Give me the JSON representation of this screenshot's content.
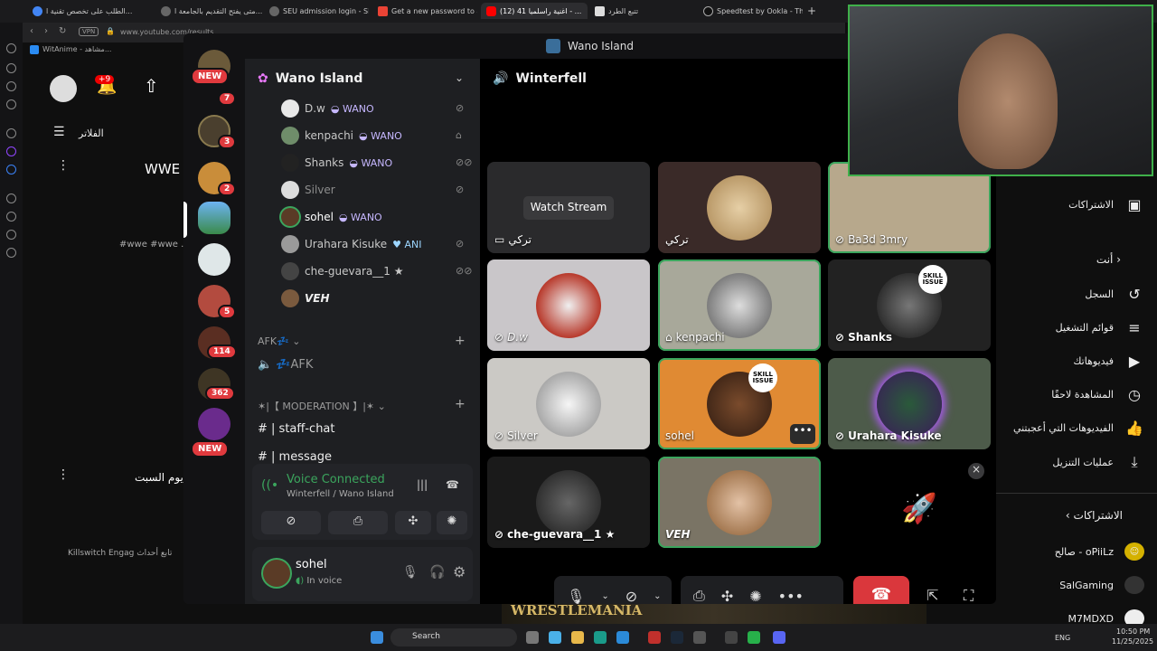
{
  "browser": {
    "tabs": [
      "الطلب على تخصص تقنية ا...",
      "متى يفتح التقديم بالجامعة ا...",
      "SEU admission login - SE",
      "Get a new password to ac",
      "(12) اغنية راسلميا 41 - ...",
      "تتبع الطرد",
      "Speedtest by Ookla - The"
    ],
    "active_tab": "(12) اغنية راسلميا 41 - ...",
    "url": "www.youtube.com/results",
    "vpn_label": "VPN",
    "bookmark": "WitAnime - مشاهد..."
  },
  "youtube": {
    "notif_count": "+9",
    "filters_label": "الفلاتر",
    "result1_title": "WWE",
    "result1_tags": "#wwe #wwe .",
    "result2_title": "يوم السبت",
    "result2_desc": "Killswitch Engag تابع أحداث",
    "sidebar": {
      "subscriptions_top": "الاشتراكات",
      "you_header": "أنت",
      "items": [
        "السجل",
        "قوائم التشغيل",
        "فيديوهاتك",
        "المشاهدة لاحقًا",
        "الفيديوهات التي أعجبتني",
        "عمليات التنزيل"
      ],
      "subs_header": "الاشتراكات",
      "subs": [
        "صالح - oPiiLz",
        "SalGaming",
        "M7MDXD"
      ]
    },
    "thumb_text": "WRESTLEMANIA"
  },
  "discord": {
    "window_title": "Wano Island",
    "server_name": "Wano Island",
    "channel_header": "Winterfell",
    "server_badges": [
      "NEW",
      "7",
      "3",
      "2",
      "5",
      "114",
      "362",
      "NEW"
    ],
    "members": [
      {
        "name": "D.w",
        "tag": "WANO"
      },
      {
        "name": "kenpachi",
        "tag": "WANO"
      },
      {
        "name": "Shanks",
        "tag": "WANO"
      },
      {
        "name": "Silver",
        "tag": ""
      },
      {
        "name": "sohel",
        "tag": "WANO"
      },
      {
        "name": "Urahara Kisuke",
        "tag": "ANI"
      },
      {
        "name": "che-guevara__1 ★",
        "tag": ""
      },
      {
        "name": "VEH",
        "tag": ""
      }
    ],
    "afk_category": "AFK💤",
    "afk_channel": "💤AFK",
    "mod_category": "✶|【 MODERATION 】|✶",
    "channels": [
      "| staff-chat",
      "| message"
    ],
    "voice_status": "Voice Connected",
    "voice_location": "Winterfell / Wano Island",
    "user_name": "sohel",
    "user_status": "In voice",
    "tiles": [
      {
        "name": "تركي",
        "stream": "Watch Stream"
      },
      {
        "name": "تركي"
      },
      {
        "name": "Ba3d 3mry"
      },
      {
        "name": "D.w"
      },
      {
        "name": "kenpachi"
      },
      {
        "name": "Shanks"
      },
      {
        "name": "Silver"
      },
      {
        "name": "sohel"
      },
      {
        "name": "Urahara Kisuke"
      },
      {
        "name": "che-guevara__1 ★"
      },
      {
        "name": "VEH"
      }
    ],
    "skill_issue": "SKILL ISSUE"
  },
  "taskbar": {
    "search": "Search",
    "lang": "ENG",
    "time": "10:50 PM",
    "date": "11/25/2025"
  },
  "colors": {
    "accent_green": "#3ba55d",
    "discord_red": "#da373c",
    "badge_red": "#e03a3e"
  }
}
